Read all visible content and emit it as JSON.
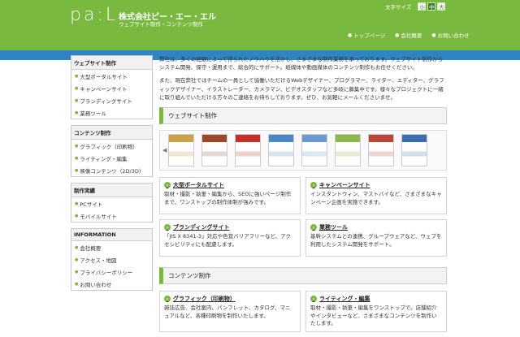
{
  "header": {
    "logo": "pa:L",
    "company": "株式会社ピー・エー・エル",
    "tagline": "ウェブサイト制作・コンテンツ制作",
    "fontsize_label": "文字サイズ",
    "fontsize_buttons": [
      "小",
      "中",
      "大"
    ],
    "nav": [
      "トップページ",
      "会社概要",
      "お問い合わせ"
    ]
  },
  "sidebar": [
    {
      "title": "ウェブサイト制作",
      "items": [
        "大型ポータルサイト",
        "キャンペーンサイト",
        "ブランディングサイト",
        "業務ツール"
      ]
    },
    {
      "title": "コンテンツ制作",
      "items": [
        "グラフィック（印刷物）",
        "ライティング・編集",
        "映像コンテンツ（2D/3D）"
      ]
    },
    {
      "title": "制作実績",
      "items": [
        "PCサイト",
        "モバイルサイト"
      ]
    },
    {
      "title": "INFORMATION",
      "items": [
        "会社概要",
        "アクセス・地図",
        "プライバシーポリシー",
        "お問い合わせ"
      ]
    }
  ],
  "main": {
    "intro1": "弊社は、多くの経験によって得られたノウハウを活かし、さまざまな制作業務を承っております。ウェブサイト制作からシステム開発、保守・運用まで、総合的にサポート。紙媒体や動画媒体のコンテンツ制作もお任せください。",
    "intro2": "また、現在弊社ではチームの一員として協働いただけるWebデザイナー、プログラマー、ライター、エディター、グラフィックデザイナー、イラストレーター、カメラマン、ビデオスタッフなど多岐に募集中です。様々なプロジェクトに一緒に取り組んでいただける方々のご連絡をお待ちしております。ぜひ、お気軽にメールくださいませ。",
    "section1": "ウェブサイト制作",
    "thumbs": [
      "#c9a24a",
      "#9a4a2a",
      "#c2322b",
      "#4a88c4",
      "#6a9ad0",
      "#8ab84f",
      "#b8463a",
      "#3d6fb0"
    ],
    "cards1": [
      {
        "title": "大型ポータルサイト",
        "text": "取材・撮影・執筆・編集から、SEOに強いページ制作まで、ワンストップの制作体制が強みです。"
      },
      {
        "title": "キャンペーンサイト",
        "text": "インスタントウィン、マストバイなど、さまざまなキャンペーン企画を実施できます。"
      },
      {
        "title": "ブランディングサイト",
        "text": "「JIS X 8341-3」対応や色覚バリアフリーなど、アクセシビリティにも配慮します。"
      },
      {
        "title": "業務ツール",
        "text": "基幹システムとの連携、グループウェアなど、ウェブを利用したシステム開発をサポート。"
      }
    ],
    "section2": "コンテンツ制作",
    "cards2": [
      {
        "title": "グラフィック（印刷物）",
        "text": "雑誌広告、会社案内、パンフレット、カタログ、マニュアルなど、各種印刷物を制作いたします。"
      },
      {
        "title": "ライティング・編集",
        "text": "取材・撮影・執筆・編集をワンストップで。店舗紹介やインタビューなど、さまざまなコンテンツを制作いたします。"
      }
    ]
  }
}
